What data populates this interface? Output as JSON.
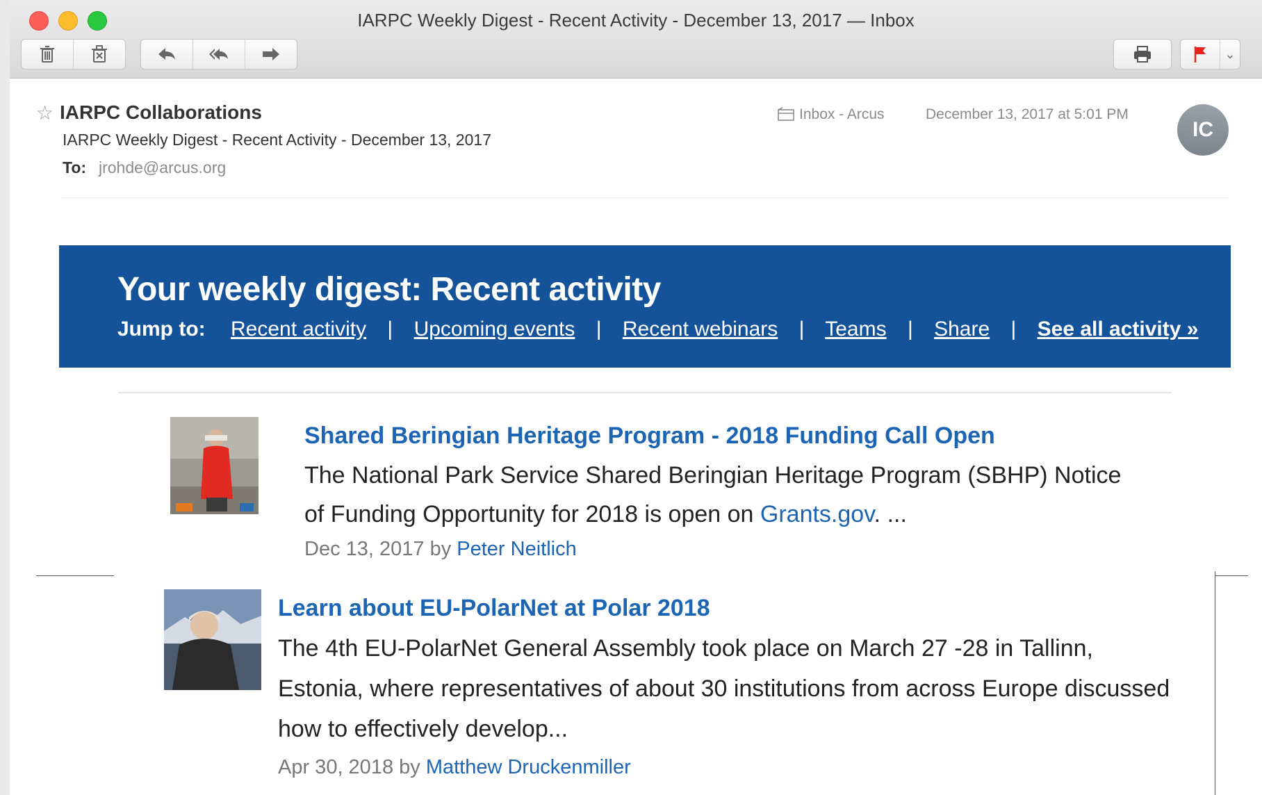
{
  "window": {
    "title": "IARPC Weekly Digest - Recent Activity - December 13, 2017 — Inbox"
  },
  "toolbar": {
    "delete_icon": "trash-icon",
    "junk_icon": "junk-icon",
    "reply_icon": "reply-icon",
    "reply_all_icon": "reply-all-icon",
    "forward_icon": "forward-icon",
    "print_icon": "printer-icon",
    "flag_icon": "flag-icon",
    "flag_color": "#e8221c"
  },
  "header": {
    "star": "☆",
    "from": "IARPC Collaborations",
    "subject": "IARPC Weekly Digest - Recent Activity - December 13, 2017",
    "to_label": "To:",
    "to": "jrohde@arcus.org",
    "mailbox": "Inbox - Arcus",
    "date": "December 13, 2017 at 5:01 PM",
    "avatar_initials": "IC"
  },
  "banner": {
    "title": "Your weekly digest: Recent activity",
    "jump_label": "Jump to:",
    "links": [
      "Recent activity",
      "Upcoming events",
      "Recent webinars",
      "Teams",
      "Share",
      "See all activity »"
    ],
    "separator": "|",
    "background": "#14529a"
  },
  "items": [
    {
      "title": "Shared Beringian Heritage Program - 2018 Funding Call Open",
      "body": "The National Park Service Shared Beringian Heritage Program (SBHP) Notice of Funding Opportunity for 2018 is open on",
      "body_link": "Grants.gov",
      "body_end": ". ...",
      "meta_prefix": "Dec 13, 2017 by",
      "author": "Peter Neitlich"
    },
    {
      "title": "Learn about EU-PolarNet at Polar 2018",
      "body": "The 4th EU-PolarNet General Assembly took place on March 27 -28 in Tallinn, Estonia, where representatives of about 30 institutions from across Europe discussed how to effectively develop...",
      "meta_prefix": "Apr 30, 2018 by",
      "author": "Matthew Druckenmiller"
    }
  ],
  "link_color": "#1c64b4"
}
